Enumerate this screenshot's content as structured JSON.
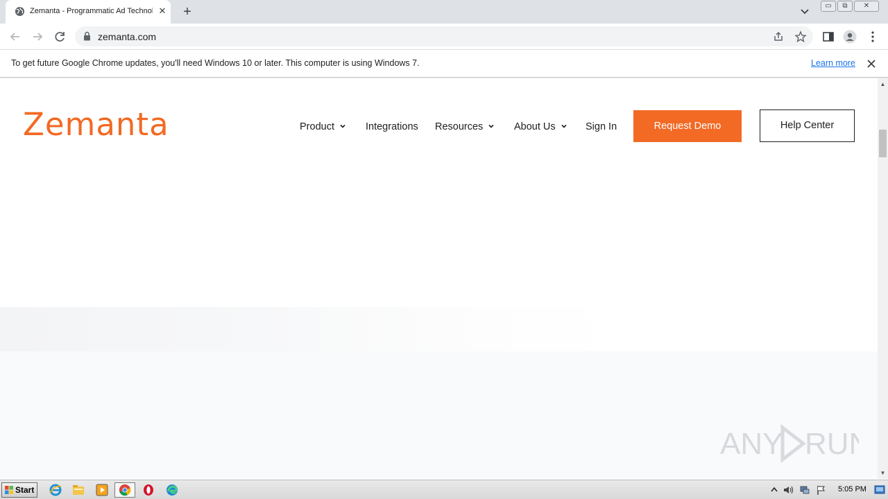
{
  "browser": {
    "tab": {
      "title": "Zemanta - Programmatic Ad Technology",
      "favicon": "globe-icon"
    },
    "new_tab_symbol": "+",
    "url": "zemanta.com",
    "window_buttons": {
      "minimize": "▭",
      "restore": "⧉",
      "close": "✕"
    }
  },
  "infobar": {
    "message": "To get future Google Chrome updates, you'll need Windows 10 or later. This computer is using Windows 7.",
    "link_label": "Learn more"
  },
  "site": {
    "logo": "Zemanta",
    "brand_color": "#f26a24",
    "nav": [
      {
        "label": "Product",
        "has_dropdown": true
      },
      {
        "label": "Integrations",
        "has_dropdown": false
      },
      {
        "label": "Resources",
        "has_dropdown": true
      },
      {
        "label": "About Us",
        "has_dropdown": true
      },
      {
        "label": "Sign In",
        "has_dropdown": false
      }
    ],
    "cta_primary": "Request Demo",
    "cta_secondary": "Help Center"
  },
  "watermark": {
    "text": "ANY RUN"
  },
  "taskbar": {
    "start_label": "Start",
    "apps": [
      "ie-icon",
      "explorer-icon",
      "media-player-icon",
      "chrome-icon",
      "opera-icon",
      "edge-icon"
    ],
    "clock": "5:05 PM"
  }
}
